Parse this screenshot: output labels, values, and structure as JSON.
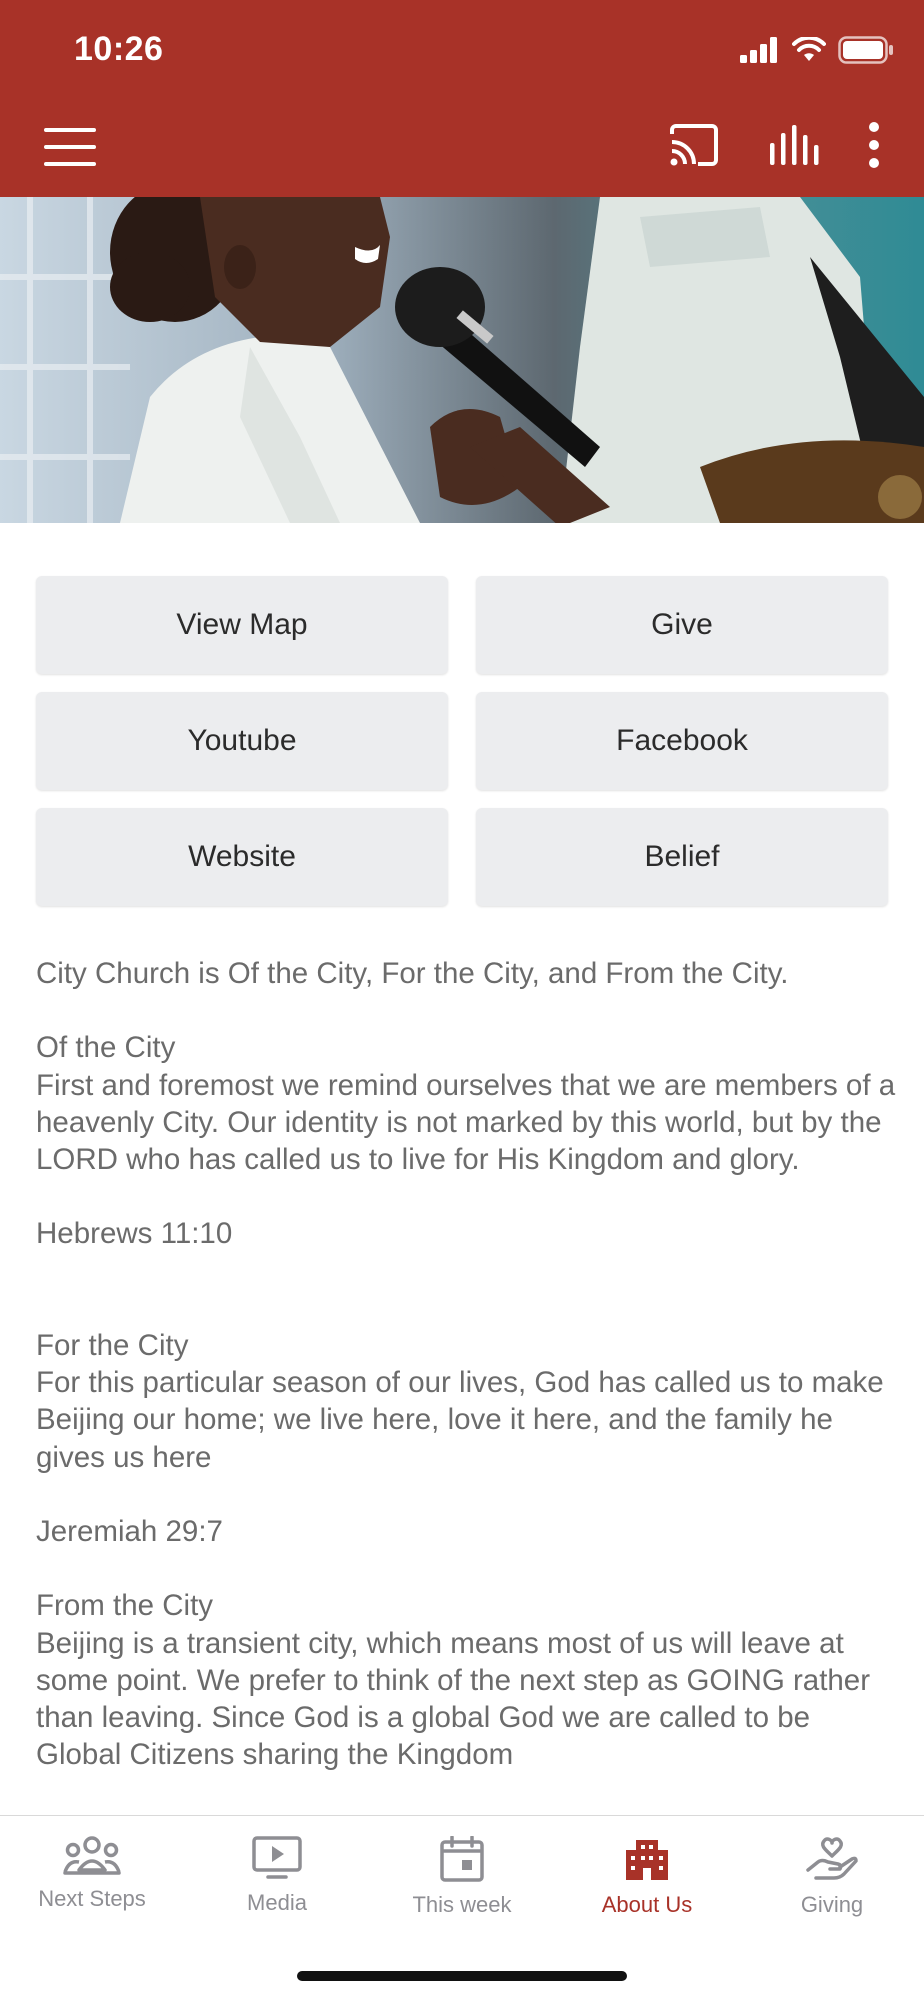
{
  "status_bar": {
    "time": "10:26"
  },
  "app_bar": {
    "menu_icon": "hamburger-menu-icon",
    "actions": [
      "cast-icon",
      "audio-bars-icon",
      "more-vertical-icon"
    ]
  },
  "hero": {
    "image": "singer-with-microphone-photo"
  },
  "buttons": {
    "view_map": "View Map",
    "give": "Give",
    "youtube": "Youtube",
    "facebook": "Facebook",
    "website": "Website",
    "belief": "Belief"
  },
  "content": {
    "intro": "City Church is Of the City, For the City, and From the City.",
    "of_heading": "Of the City",
    "of_body": "First and foremost we remind ourselves that we are members of a heavenly City. Our identity is not marked by this world, but by the LORD who has called us to live for His Kingdom and glory.",
    "of_verse": "Hebrews 11:10",
    "for_heading": "For the City",
    "for_body": "For this particular season of our lives, God has called us to make Beijing our home; we live here, love it here, and the family he gives us here",
    "for_verse": "Jeremiah 29:7",
    "from_heading": "From the City",
    "from_body": "Beijing is a transient city, which means most of us will leave at some point. We prefer to think of the next step as GOING rather than leaving. Since God is a global God we are called to be Global Citizens sharing the Kingdom"
  },
  "tabs": {
    "next_steps": "Next Steps",
    "media": "Media",
    "this_week": "This week",
    "about_us": "About Us",
    "giving": "Giving"
  },
  "colors": {
    "brand": "#A83228",
    "button_bg": "#ECEDEF",
    "inactive": "#8E8E93"
  }
}
